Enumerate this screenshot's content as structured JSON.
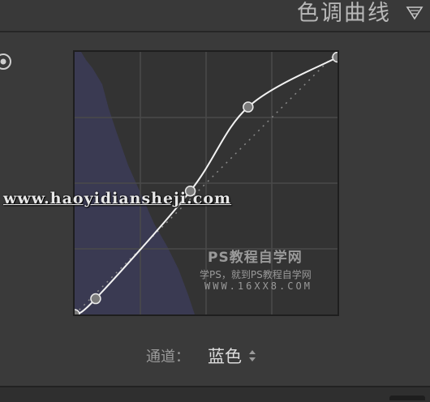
{
  "panel": {
    "title": "色调曲线"
  },
  "channel": {
    "label": "通道：",
    "value": "蓝色"
  },
  "watermarks": {
    "url": "www.haoyidiansheji.com",
    "title": "PS教程自学网",
    "subtitle": "学PS，就到PS教程自学网",
    "site": "WWW.16XX8.COM"
  },
  "colors": {
    "curve": "#f2f2f2",
    "histogram": "#3a3a52",
    "background": "#3a3a3a"
  },
  "icons": [
    "target-adjustment-icon",
    "collapse-triangle-icon",
    "up-down-arrows-icon"
  ],
  "curve_points": [
    {
      "input": 0,
      "output": 0
    },
    {
      "input": 8,
      "output": 6
    },
    {
      "input": 44,
      "output": 47
    },
    {
      "input": 66,
      "output": 79
    },
    {
      "input": 100,
      "output": 98
    }
  ]
}
